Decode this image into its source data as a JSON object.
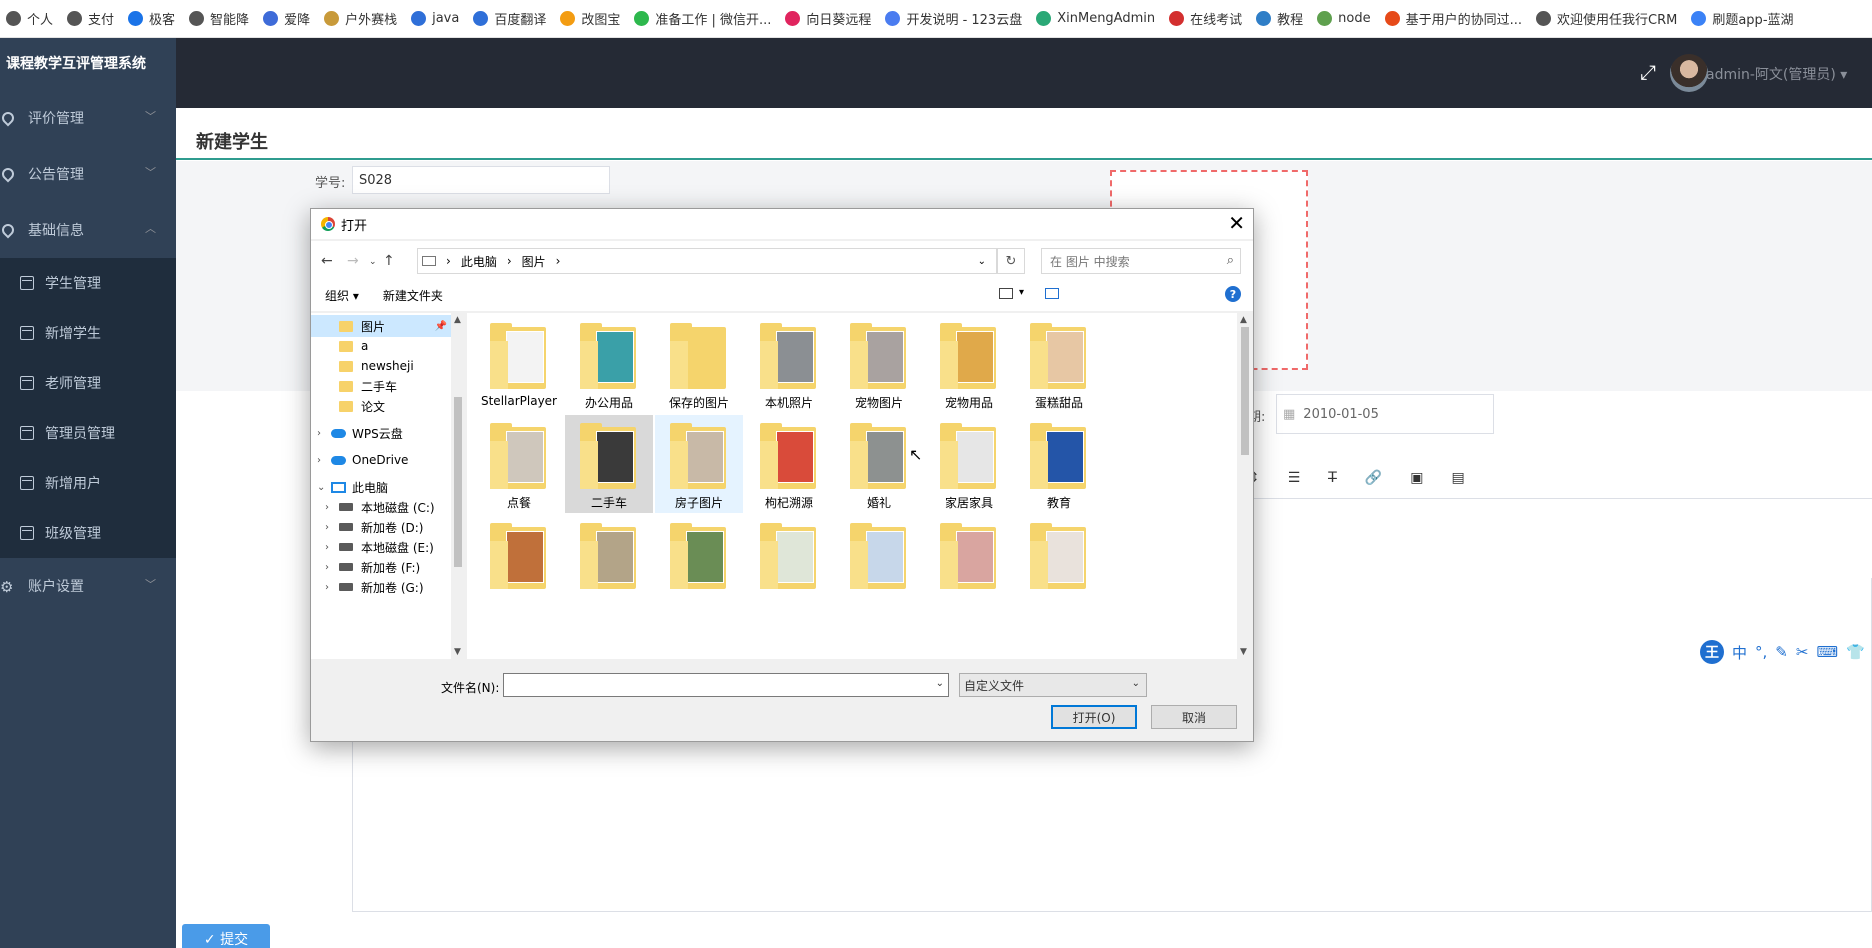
{
  "bookmarks": [
    {
      "label": "个人",
      "color": "#555555"
    },
    {
      "label": "支付",
      "color": "#555555"
    },
    {
      "label": "极客",
      "color": "#1a73e8"
    },
    {
      "label": "智能降",
      "color": "#555555"
    },
    {
      "label": "爱降",
      "color": "#3e6bd8"
    },
    {
      "label": "户外赛栈",
      "color": "#c89a3a"
    },
    {
      "label": "java",
      "color": "#2f6fd8"
    },
    {
      "label": "百度翻译",
      "color": "#2f6fd8"
    },
    {
      "label": "改图宝",
      "color": "#f39c12"
    },
    {
      "label": "准备工作 | 微信开...",
      "color": "#2db84d"
    },
    {
      "label": "向日葵远程",
      "color": "#e0245e"
    },
    {
      "label": "开发说明 - 123云盘",
      "color": "#4a7cf0"
    },
    {
      "label": "XinMengAdmin",
      "color": "#2aa876"
    },
    {
      "label": "在线考试",
      "color": "#d32f2f"
    },
    {
      "label": "教程",
      "color": "#2f7ec7"
    },
    {
      "label": "node",
      "color": "#5fa04e"
    },
    {
      "label": "基于用户的协同过...",
      "color": "#e64a19"
    },
    {
      "label": "欢迎使用任我行CRM",
      "color": "#555555"
    },
    {
      "label": "刷题app-蓝湖",
      "color": "#3b82f6"
    }
  ],
  "sidebar": {
    "title": "课程教学互评管理系统",
    "menu1": "评价管理",
    "menu2": "公告管理",
    "menu3": "基础信息",
    "sub": [
      "学生管理",
      "新增学生",
      "老师管理",
      "管理员管理",
      "新增用户",
      "班级管理"
    ],
    "menu4": "账户设置"
  },
  "navbar": {
    "user_label": "admin-阿文(管理员)"
  },
  "page": {
    "title": "新建学生",
    "student_id_label": "学号:",
    "student_id_value": "S028",
    "date_label": "期:",
    "date_value": "2010-01-05",
    "submit_label": "✓ 提交"
  },
  "ime": {
    "logo": "王",
    "items": [
      "中",
      "°,",
      "✎",
      "✂",
      "⌨",
      "👕"
    ]
  },
  "dialog": {
    "title": "打开",
    "breadcrumb": [
      "此电脑",
      "图片"
    ],
    "search_placeholder": "在 图片 中搜索",
    "organize": "组织 ▾",
    "new_folder": "新建文件夹",
    "tree": [
      {
        "label": "图片",
        "type": "folder",
        "selected": true
      },
      {
        "label": "a",
        "type": "folder"
      },
      {
        "label": "newsheji",
        "type": "folder"
      },
      {
        "label": "二手车",
        "type": "folder"
      },
      {
        "label": "论文",
        "type": "folder"
      },
      {
        "label": "WPS云盘",
        "type": "cloud"
      },
      {
        "label": "OneDrive",
        "type": "cloud"
      },
      {
        "label": "此电脑",
        "type": "pc"
      },
      {
        "label": "本地磁盘 (C:)",
        "type": "drive"
      },
      {
        "label": "新加卷 (D:)",
        "type": "drive"
      },
      {
        "label": "本地磁盘 (E:)",
        "type": "drive"
      },
      {
        "label": "新加卷 (F:)",
        "type": "drive"
      },
      {
        "label": "新加卷 (G:)",
        "type": "drive"
      }
    ],
    "files": [
      {
        "name": "StellarPlayer",
        "tint": "#f3f3f3"
      },
      {
        "name": "办公用品",
        "tint": "#3aa0a8"
      },
      {
        "name": "保存的图片",
        "tint": "#f5d46c"
      },
      {
        "name": "本机照片",
        "tint": "#8b8f93"
      },
      {
        "name": "宠物图片",
        "tint": "#a9a2a0"
      },
      {
        "name": "宠物用品",
        "tint": "#e0a94a"
      },
      {
        "name": "蛋糕甜品",
        "tint": "#e7c7a4"
      },
      {
        "name": "点餐",
        "tint": "#cfc7bc"
      },
      {
        "name": "二手车",
        "tint": "#3a3a3a"
      },
      {
        "name": "房子图片",
        "tint": "#c8b9a7"
      },
      {
        "name": "枸杞溯源",
        "tint": "#d94b3a"
      },
      {
        "name": "婚礼",
        "tint": "#8d9190"
      },
      {
        "name": "家居家具",
        "tint": "#e6e6e6"
      },
      {
        "name": "教育",
        "tint": "#2455a8"
      },
      {
        "name": "",
        "tint": "#c0703a"
      },
      {
        "name": "",
        "tint": "#b3a488"
      },
      {
        "name": "",
        "tint": "#6a8d55"
      },
      {
        "name": "",
        "tint": "#dfe6d8"
      },
      {
        "name": "",
        "tint": "#c7d7ea"
      },
      {
        "name": "",
        "tint": "#d9a5a0"
      },
      {
        "name": "",
        "tint": "#e9e2dc"
      }
    ],
    "filename_label": "文件名(N):",
    "filename_value": "",
    "filter_value": "自定义文件",
    "open_label": "打开(O)",
    "cancel_label": "取消"
  }
}
